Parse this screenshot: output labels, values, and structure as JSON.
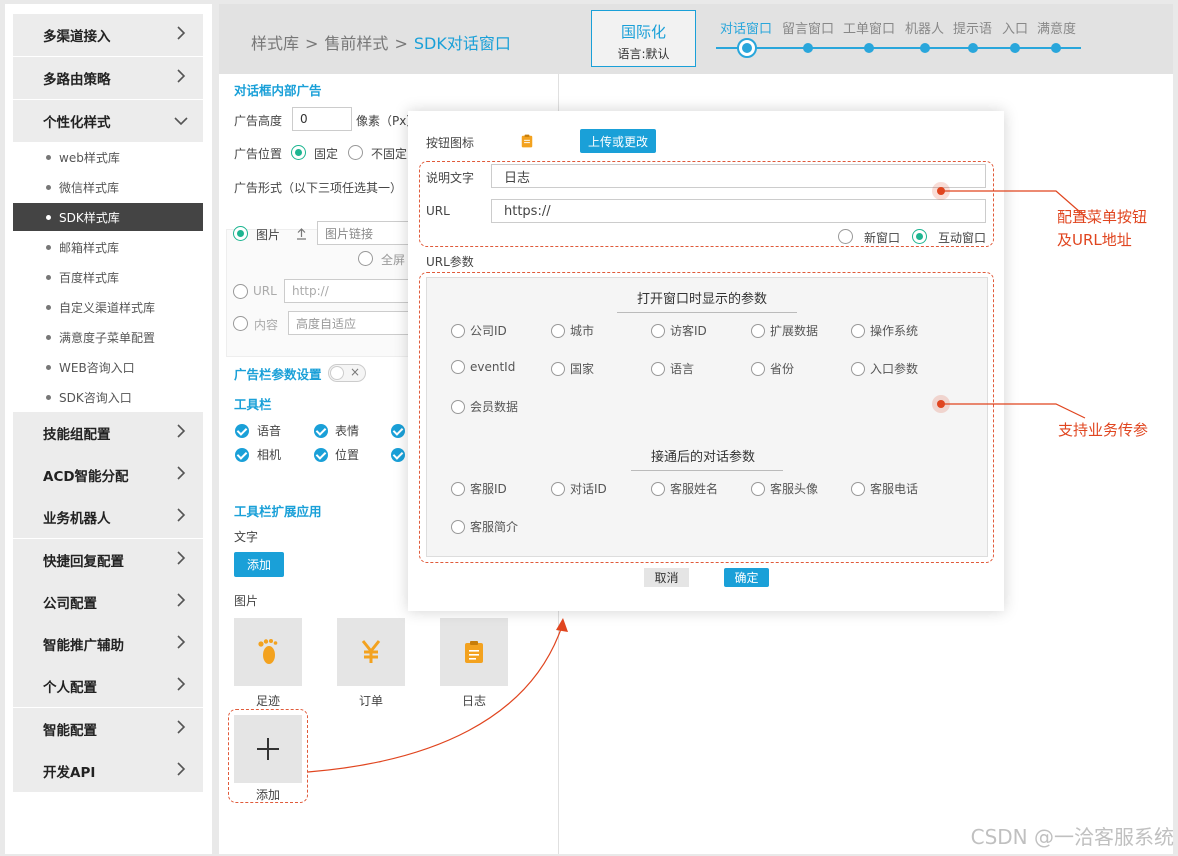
{
  "sidebar": {
    "groups_top": [
      {
        "label": "多渠道接入"
      },
      {
        "label": "多路由策略"
      },
      {
        "label": "个性化样式"
      }
    ],
    "sub_items": [
      {
        "label": "web样式库"
      },
      {
        "label": "微信样式库"
      },
      {
        "label": "SDK样式库"
      },
      {
        "label": "邮箱样式库"
      },
      {
        "label": "百度样式库"
      },
      {
        "label": "自定义渠道样式库"
      },
      {
        "label": "满意度子菜单配置"
      },
      {
        "label": "WEB咨询入口"
      },
      {
        "label": "SDK咨询入口"
      }
    ],
    "groups_bottom": [
      {
        "label": "技能组配置"
      },
      {
        "label": "ACD智能分配"
      },
      {
        "label": "业务机器人"
      },
      {
        "label": "快捷回复配置"
      },
      {
        "label": "公司配置"
      },
      {
        "label": "智能推广辅助"
      },
      {
        "label": "个人配置"
      },
      {
        "label": "智能配置"
      },
      {
        "label": "开发API"
      }
    ]
  },
  "breadcrumb": {
    "items": [
      "样式库",
      "售前样式",
      "SDK对话窗口"
    ],
    "sep": ">"
  },
  "i18n": {
    "title": "国际化",
    "lang": "语言:默认"
  },
  "steps": [
    "对话窗口",
    "留言窗口",
    "工单窗口",
    "机器人",
    "提示语",
    "入口",
    "满意度"
  ],
  "colors": {
    "accent": "#1aa0d8",
    "radio_on": "#1db591",
    "annotation": "#e0451f"
  },
  "form": {
    "ad_section": "对话框内部广告",
    "ad_height_label": "广告高度",
    "ad_height_value": "0",
    "ad_height_unit": "像素（Px）",
    "ad_position_label": "广告位置",
    "pos_fixed": "固定",
    "pos_unfixed": "不固定",
    "ad_form_label": "广告形式（以下三项任选其一）",
    "opt_image": "图片",
    "image_link_placeholder": "图片链接",
    "fullscreen": "全屏",
    "opt_url": "URL",
    "url_placeholder": "http://",
    "opt_content": "内容",
    "content_placeholder": "高度自适应",
    "ad_bar_settings": "广告栏参数设置",
    "toolbar_section": "工具栏",
    "toolbar_items": [
      "语音",
      "表情",
      "相机",
      "位置"
    ],
    "toolbar_ext_section": "工具栏扩展应用",
    "text_label": "文字",
    "add_label": "添加",
    "image_label": "图片",
    "thumbs": [
      {
        "label": "足迹",
        "icon": "footprint-icon"
      },
      {
        "label": "订单",
        "icon": "yen-icon"
      },
      {
        "label": "日志",
        "icon": "clipboard-icon"
      }
    ],
    "add_tile_label": "添加"
  },
  "modal": {
    "button_icon_label": "按钮图标",
    "upload_label": "上传或更改",
    "desc_label": "说明文字",
    "desc_value": "日志",
    "url_label": "URL",
    "url_value": "https://",
    "new_window": "新窗口",
    "interactive_window": "互动窗口",
    "url_params_label": "URL参数",
    "open_params_title": "打开窗口时显示的参数",
    "open_params": [
      "公司ID",
      "城市",
      "访客ID",
      "扩展数据",
      "操作系统",
      "eventId",
      "国家",
      "语言",
      "省份",
      "入口参数",
      "会员数据"
    ],
    "after_params_title": "接通后的对话参数",
    "after_params": [
      "客服ID",
      "对话ID",
      "客服姓名",
      "客服头像",
      "客服电话",
      "客服简介"
    ],
    "cancel": "取消",
    "confirm": "确定"
  },
  "annotations": {
    "menu_line1": "配置菜单按钮",
    "menu_line2": "及URL地址",
    "params": "支持业务传参"
  },
  "watermark": "CSDN @一洽客服系统"
}
